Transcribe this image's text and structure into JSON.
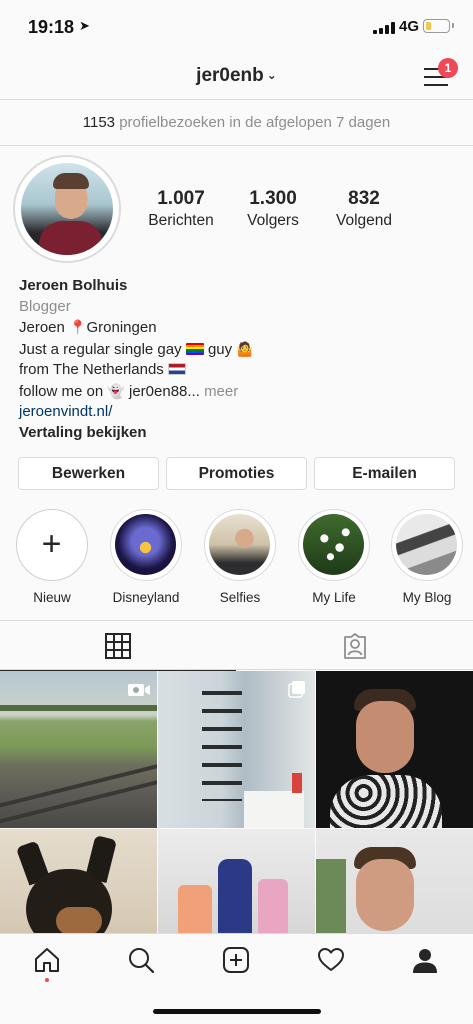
{
  "status_bar": {
    "time": "19:18",
    "network": "4G"
  },
  "header": {
    "username": "jer0enb",
    "notification_count": "1"
  },
  "visits": {
    "count": "1153",
    "text": "profielbezoeken in de afgelopen 7 dagen"
  },
  "stats": [
    {
      "value": "1.007",
      "label": "Berichten"
    },
    {
      "value": "1.300",
      "label": "Volgers"
    },
    {
      "value": "832",
      "label": "Volgend"
    }
  ],
  "bio": {
    "name": "Jeroen Bolhuis",
    "category": "Blogger",
    "line1_a": "Jeroen",
    "line1_b": "Groningen",
    "line2_a": "Just a regular single gay",
    "line2_b": "guy",
    "line3": "from The Netherlands",
    "line4_a": "follow me on",
    "line4_b": "jer0en88...",
    "more": "meer",
    "link": "jeroenvindt.nl/",
    "translate": "Vertaling bekijken"
  },
  "buttons": {
    "edit": "Bewerken",
    "promotions": "Promoties",
    "email": "E-mailen"
  },
  "highlights": [
    {
      "label": "Nieuw"
    },
    {
      "label": "Disneyland"
    },
    {
      "label": "Selfies"
    },
    {
      "label": "My Life"
    },
    {
      "label": "My Blog"
    }
  ],
  "icons": {
    "location": "location-arrow-icon",
    "menu": "hamburger-menu-icon",
    "pin": "map-pin-icon",
    "grid_tab": "grid-icon",
    "tagged_tab": "tagged-person-icon",
    "nav": [
      "home-icon",
      "search-icon",
      "add-post-icon",
      "heart-icon",
      "profile-icon"
    ]
  },
  "colors": {
    "badge": "#ed4956",
    "link": "#003569",
    "battery": "#f2c94c"
  }
}
